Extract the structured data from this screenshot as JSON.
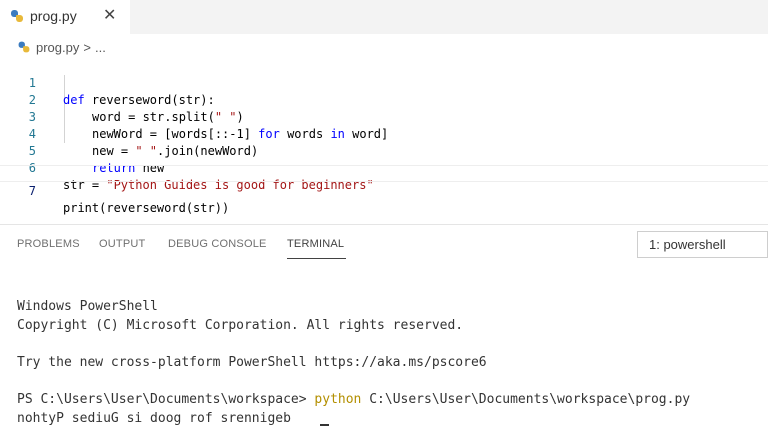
{
  "tab": {
    "filename": "prog.py",
    "close_glyph": "✕",
    "icon": "python-icon"
  },
  "breadcrumb": {
    "file": "prog.py",
    "separator": ">",
    "more": "..."
  },
  "editor": {
    "lines": [
      {
        "number": "1"
      },
      {
        "number": "2"
      },
      {
        "number": "3"
      },
      {
        "number": "4"
      },
      {
        "number": "5"
      },
      {
        "number": "6"
      },
      {
        "number": "7"
      }
    ],
    "tokens": {
      "l1_def": "def",
      "l1_rest": " reverseword(str):",
      "l2_a": "word = str.split(",
      "l2_str": "\" \"",
      "l2_b": ")",
      "l3_a": "newWord = [words[::-1] ",
      "l3_for": "for",
      "l3_b": " words ",
      "l3_in": "in",
      "l3_c": " word]",
      "l4_a": "new = ",
      "l4_str": "\" \"",
      "l4_b": ".join(newWord)",
      "l5_return": "return",
      "l5_rest": " new",
      "l6_a": "str = ",
      "l6_str": "\"Python Guides is good for beginners\"",
      "l7": "print(reverseword(str))"
    }
  },
  "panel": {
    "tabs": [
      "PROBLEMS",
      "OUTPUT",
      "DEBUG CONSOLE",
      "TERMINAL"
    ],
    "active_tab": "TERMINAL",
    "terminal_selector": "1: powershell"
  },
  "terminal": {
    "line1": "Windows PowerShell",
    "line2": "Copyright (C) Microsoft Corporation. All rights reserved.",
    "line3": "Try the new cross-platform PowerShell https://aka.ms/pscore6",
    "prompt": "PS C:\\Users\\User\\Documents\\workspace> ",
    "command": "python",
    "command_arg": " C:\\Users\\User\\Documents\\workspace\\prog.py",
    "output": "nohtyP sediuG si doog rof srennigeb"
  },
  "colors": {
    "keyword": "#0000ff",
    "string": "#a31515",
    "line_number": "#237893",
    "command": "#b38f00"
  }
}
